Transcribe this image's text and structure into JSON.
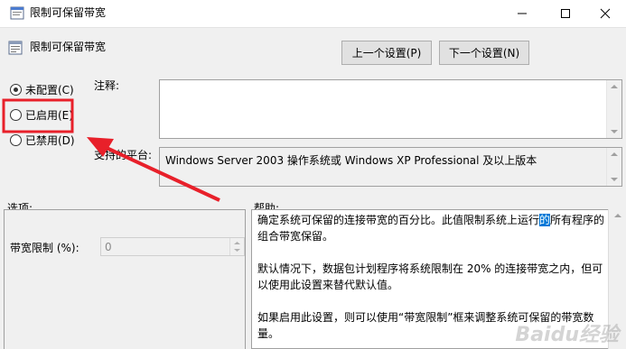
{
  "window": {
    "title": "限制可保留带宽",
    "controls": [
      "minimize-icon",
      "maximize-icon",
      "close-icon"
    ]
  },
  "header": {
    "title": "限制可保留带宽",
    "prev_label": "上一个设置(P)",
    "next_label": "下一个设置(N)"
  },
  "state_options": [
    {
      "label": "未配置(C)",
      "checked": true
    },
    {
      "label": "已启用(E)",
      "checked": false
    },
    {
      "label": "已禁用(D)",
      "checked": false
    }
  ],
  "comment": {
    "label": "注释:",
    "value": ""
  },
  "supported": {
    "label": "支持的平台:",
    "value": "Windows Server 2003 操作系统或 Windows XP Professional 及以上版本"
  },
  "options": {
    "label": "选项:",
    "bandwidth_label": "带宽限制 (%):",
    "bandwidth_value": "0"
  },
  "help": {
    "label": "帮助:",
    "p1_before": "确定系统可保留的连接带宽的百分比。此值限制系统上运行",
    "p1_highlight": "的",
    "p1_after": "所有程序的组合带宽保留。",
    "p2": "默认情况下，数据包计划程序将系统限制在 20% 的连接带宽之内，但可以使用此设置来替代默认值。",
    "p3": "如果启用此设置，则可以使用“带宽限制”框来调整系统可保留的带宽数量。"
  },
  "annotation": {
    "highlight_color": "#e8202a"
  },
  "watermark": "Baidu经验"
}
